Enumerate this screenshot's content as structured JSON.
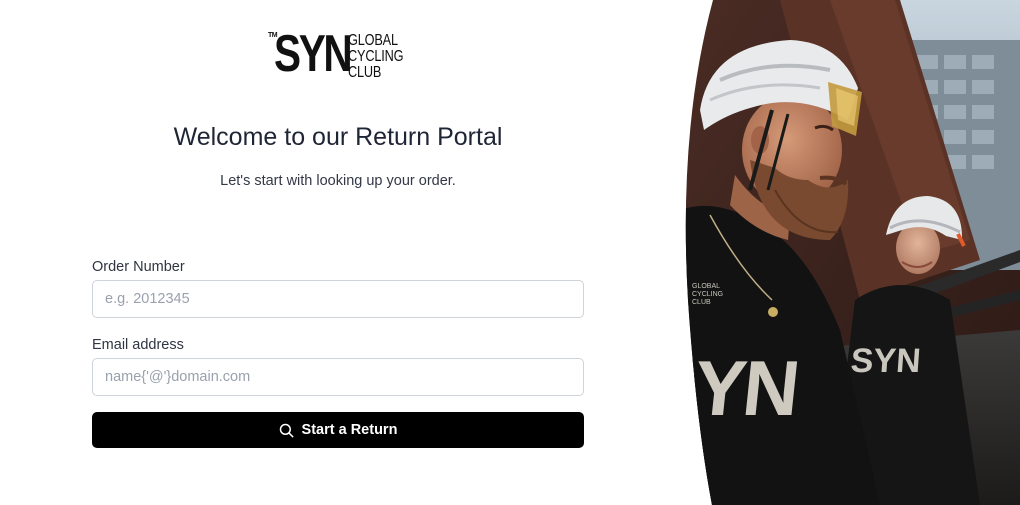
{
  "brand": {
    "tm": "TM",
    "mark": "SYN",
    "tagline": [
      "GLOBAL",
      "CYCLING",
      "CLUB"
    ]
  },
  "header": {
    "title": "Welcome to our Return Portal",
    "subtitle": "Let's start with looking up your order."
  },
  "form": {
    "order_number": {
      "label": "Order Number",
      "value": "",
      "placeholder": "e.g. 2012345"
    },
    "email": {
      "label": "Email address",
      "value": "",
      "placeholder": "name{'@'}domain.com"
    },
    "submit_label": "Start a Return",
    "submit_icon": "search-icon"
  },
  "hero": {
    "description_icon": "cyclists-photo",
    "jersey_text": "SYN",
    "jersey_badge": [
      "GLOBAL",
      "CYCLING",
      "CLUB"
    ]
  },
  "colors": {
    "button_bg": "#000000",
    "button_text": "#ffffff",
    "title_text": "#1e2534",
    "input_border": "#cfd3da",
    "placeholder": "#9aa1ad"
  }
}
